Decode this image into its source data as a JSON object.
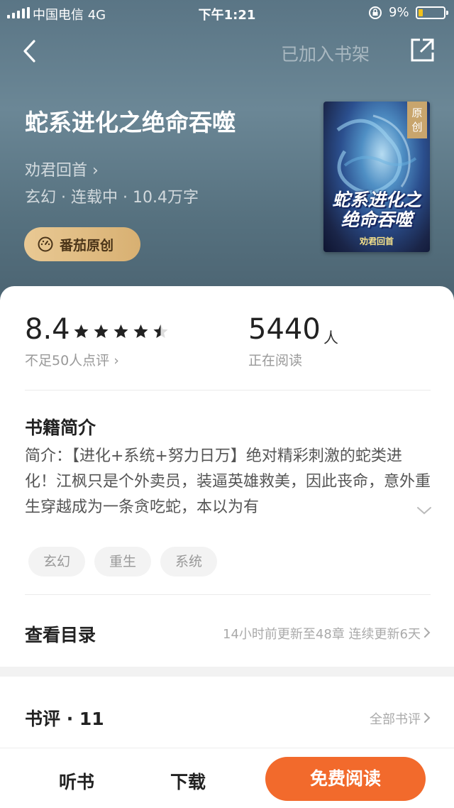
{
  "status_bar": {
    "carrier": "中国电信",
    "network": "4G",
    "time": "下午1:21",
    "battery": "9%",
    "battery_level": 0.09
  },
  "header": {
    "shelf_status": "已加入书架",
    "back_icon": "chevron-left-icon",
    "share_icon": "share-icon"
  },
  "book": {
    "title": "蛇系进化之绝命吞噬",
    "author": "劝君回首 ›",
    "meta": "玄幻 · 连载中 · 10.4万字",
    "badge_label": "番茄原创",
    "cover": {
      "orig_tag": "原创",
      "title_art": "蛇系进化之\n绝命吞噬",
      "author_art": "劝君回首"
    }
  },
  "stats": {
    "rating": "8.4",
    "stars": 4.5,
    "rating_note": "不足50人点评 ›",
    "readers": "5440",
    "readers_unit": "人",
    "readers_note": "正在阅读"
  },
  "summary": {
    "heading": "书籍简介",
    "text": "简介：【进化+系统+努力日万】绝对精彩刺激的蛇类进化！江枫只是个外卖员，装逼英雄救美，因此丧命，意外重生穿越成为一条贪吃蛇，本以为有"
  },
  "tags": [
    "玄幻",
    "重生",
    "系统"
  ],
  "toc": {
    "label": "查看目录",
    "update": "14小时前更新至48章 连续更新6天"
  },
  "reviews": {
    "title": "书评 · 11",
    "all_link": "全部书评"
  },
  "bottom_bar": {
    "listen": "听书",
    "download": "下载",
    "read": "免费阅读"
  },
  "colors": {
    "accent": "#f26a2c",
    "badge_gold": "#d8b072",
    "battery": "#f2c21b"
  }
}
